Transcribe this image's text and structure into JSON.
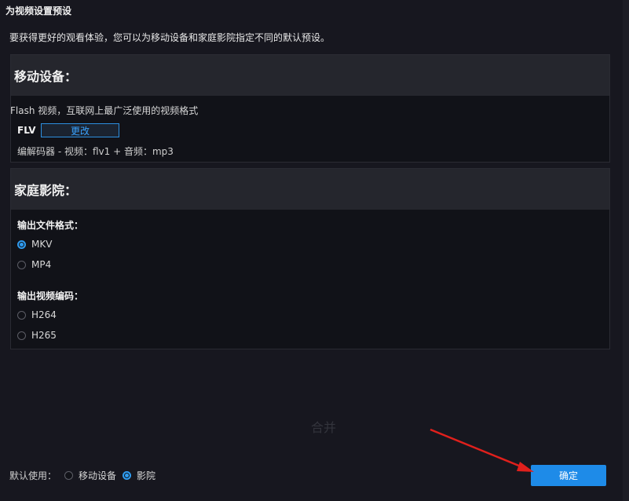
{
  "dialog": {
    "title": "为视频设置预设",
    "intro": "要获得更好的观看体验，您可以为移动设备和家庭影院指定不同的默认预设。"
  },
  "mobile": {
    "title": "移动设备：",
    "description": "Flash 视频，互联网上最广泛使用的视频格式",
    "format": "FLV",
    "change_label": "更改",
    "codec": "编解码器 - 视频：flv1 + 音频：mp3"
  },
  "home": {
    "title": "家庭影院：",
    "file_format_label": "输出文件格式：",
    "file_formats": [
      {
        "label": "MKV",
        "selected": true
      },
      {
        "label": "MP4",
        "selected": false
      }
    ],
    "video_codec_label": "输出视频编码：",
    "video_codecs": [
      {
        "label": "H264",
        "selected": false
      },
      {
        "label": "H265",
        "selected": false
      }
    ]
  },
  "background": {
    "merge_text": "合并"
  },
  "footer": {
    "default_label": "默认使用：",
    "options": [
      {
        "label": "移动设备",
        "selected": false
      },
      {
        "label": "影院",
        "selected": true
      }
    ],
    "ok_label": "确定"
  },
  "colors": {
    "accent": "#2f9cf0",
    "arrow": "#e0201c"
  }
}
